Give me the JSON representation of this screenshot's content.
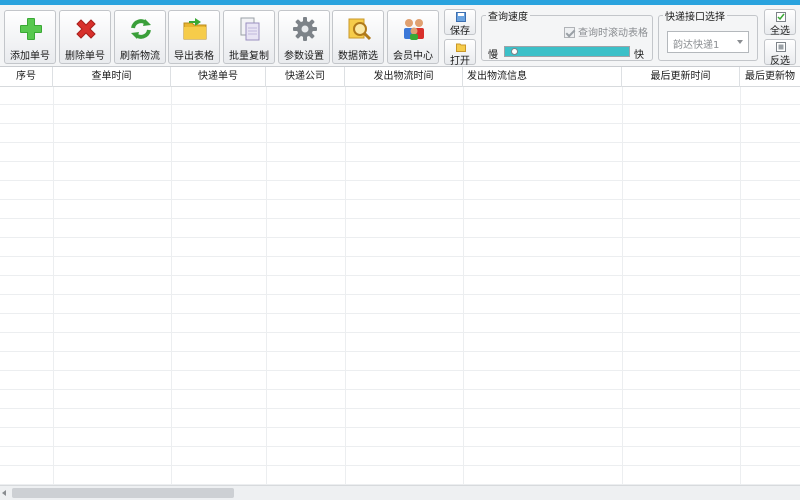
{
  "toolbar": {
    "buttons": [
      {
        "label": "添加单号",
        "icon": "plus-icon"
      },
      {
        "label": "删除单号",
        "icon": "delete-x-icon"
      },
      {
        "label": "刷新物流",
        "icon": "refresh-icon"
      },
      {
        "label": "导出表格",
        "icon": "export-folder-icon"
      },
      {
        "label": "批量复制",
        "icon": "copy-icon"
      },
      {
        "label": "参数设置",
        "icon": "gear-icon"
      },
      {
        "label": "数据筛选",
        "icon": "filter-search-icon"
      },
      {
        "label": "会员中心",
        "icon": "members-icon"
      }
    ],
    "save_label": "保存",
    "open_label": "打开",
    "select_all_label": "全选",
    "invert_label": "反选"
  },
  "speed": {
    "title": "查询速度",
    "checkbox_label": "查询时滚动表格",
    "checkbox_checked": true,
    "slow_label": "慢",
    "fast_label": "快",
    "level": 0.05
  },
  "api": {
    "title": "快递接口选择",
    "selected": "韵达快递1"
  },
  "table": {
    "columns": [
      "序号",
      "查单时间",
      "快递单号",
      "快递公司",
      "发出物流时间",
      "发出物流信息",
      "最后更新时间",
      "最后更新物"
    ],
    "rows": []
  },
  "colors": {
    "accent": "#2aa3de",
    "progress": "#3cc0c8"
  }
}
